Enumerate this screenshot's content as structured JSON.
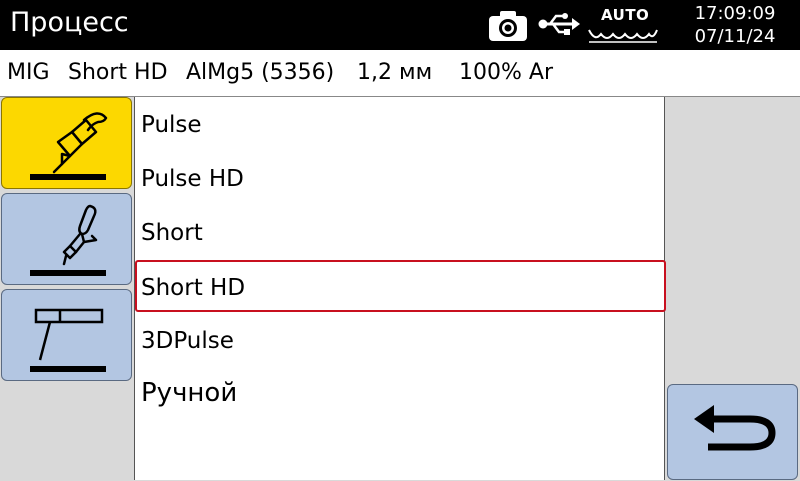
{
  "header": {
    "title": "Процесс",
    "auto_label": "AUTO",
    "time": "17:09:09",
    "date": "07/11/24",
    "icons": [
      "camera-icon",
      "usb-icon",
      "auto-icon"
    ]
  },
  "info": {
    "process": "MIG",
    "mode": "Short HD",
    "material": "AlMg5 (5356)",
    "wire": "1,2 мм",
    "gas": "100% Ar"
  },
  "tools": [
    {
      "icon": "mig-torch-icon",
      "active": true
    },
    {
      "icon": "tig-torch-icon",
      "active": false
    },
    {
      "icon": "mma-electrode-icon",
      "active": false
    }
  ],
  "list": {
    "items": [
      "Pulse",
      "Pulse HD",
      "Short",
      "Short HD",
      "3DPulse",
      "Ручной"
    ],
    "selected": "Short HD"
  },
  "back_button": {
    "icon": "back-arrow-icon"
  },
  "colors": {
    "header_bg": "#000000",
    "active_tool": "#fcd800",
    "tool_bg": "#b3c6e2",
    "selection_border": "#c8101f"
  }
}
